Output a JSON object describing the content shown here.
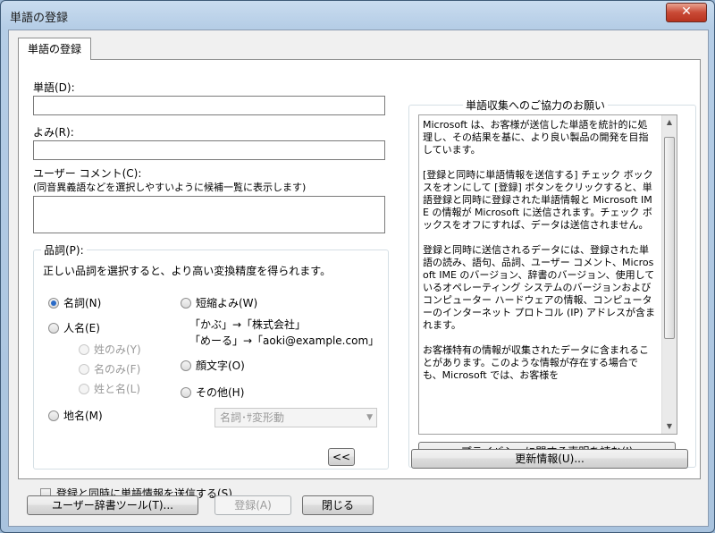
{
  "window": {
    "title": "単語の登録",
    "close_glyph": "✕"
  },
  "tab": {
    "label": "単語の登録"
  },
  "word": {
    "label": "単語(D):",
    "value": ""
  },
  "reading": {
    "label": "よみ(R):",
    "value": ""
  },
  "comment": {
    "label": "ユーザー コメント(C):",
    "hint": "(同音異義語などを選択しやすいように候補一覧に表示します)",
    "value": ""
  },
  "pos": {
    "group_label": "品詞(P):",
    "description": "正しい品詞を選択すると、より高い変換精度を得られます。",
    "options": {
      "noun": "名詞(N)",
      "person": "人名(E)",
      "surname_only": "姓のみ(Y)",
      "given_only": "名のみ(F)",
      "surname_given": "姓と名(L)",
      "place": "地名(M)",
      "short_reading": "短縮よみ(W)",
      "face_mark": "顔文字(O)",
      "other": "その他(H)"
    },
    "short_example_1": "「かぶ」→「株式会社」",
    "short_example_2": "「めーる」→「aoki@example.com」",
    "other_combo_value": "名詞･ｻ変形動"
  },
  "send_checkbox": {
    "label": "登録と同時に単語情報を送信する(S)",
    "checked": false
  },
  "collapse_button": {
    "label": "<<"
  },
  "info": {
    "group_label": "単語収集へのご協力のお願い",
    "text": "Microsoft は、お客様が送信した単語を統計的に処理し、その結果を基に、より良い製品の開発を目指しています。\n\n[登録と同時に単語情報を送信する] チェック ボックスをオンにして [登録] ボタンをクリックすると、単語登録と同時に登録された単語情報と Microsoft IME の情報が Microsoft に送信されます。チェック ボックスをオフにすれば、データは送信されません。\n\n登録と同時に送信されるデータには、登録された単語の読み、語句、品詞、ユーザー コメント、Microsoft IME のバージョン、辞書のバージョン、使用しているオペレーティング システムのバージョンおよびコンピューター ハードウェアの情報、コンピューターのインターネット プロトコル (IP) アドレスが含まれます。\n\nお客様特有の情報が収集されたデータに含まれることがあります。このような情報が存在する場合でも、Microsoft では、お客様を",
    "privacy_button": "プライバシーに関する声明を読む(I)",
    "update_button": "更新情報(U)..."
  },
  "footer": {
    "user_dict_button": "ユーザー辞書ツール(T)...",
    "register_button": "登録(A)",
    "close_button": "閉じる"
  }
}
